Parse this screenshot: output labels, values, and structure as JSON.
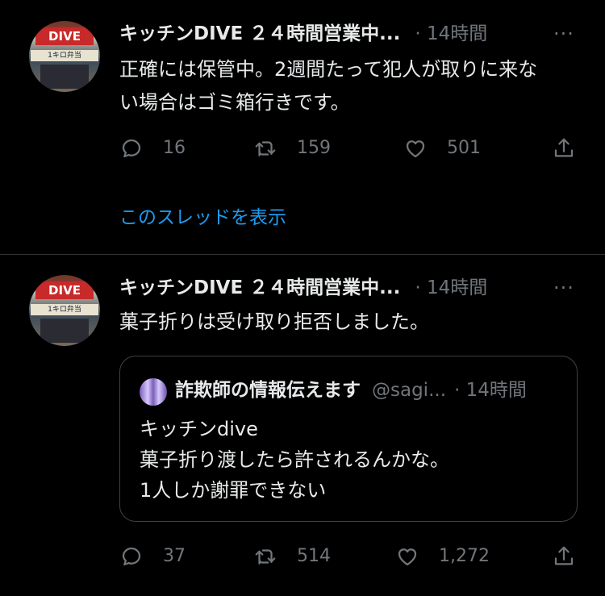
{
  "tweets": [
    {
      "avatar_sign": "DIVE",
      "avatar_banner": "1キロ弁当",
      "name": "キッチンDIVE ２４時間営業中...",
      "time": "· 14時間",
      "more": "···",
      "text_lines": [
        "正確には保管中。2週間たって犯人が取りに来な",
        "い場合はゴミ箱行きです。"
      ],
      "replies": "16",
      "retweets": "159",
      "likes": "501",
      "show_thread": "このスレッドを表示"
    },
    {
      "avatar_sign": "DIVE",
      "avatar_banner": "1キロ弁当",
      "name": "キッチンDIVE ２４時間営業中...",
      "time": "· 14時間",
      "more": "···",
      "text_lines": [
        "菓子折りは受け取り拒否しました。"
      ],
      "quote": {
        "name": "詐欺師の情報伝えます",
        "handle": "@sagi...",
        "time": "· 14時間",
        "text_lines": [
          "キッチンdive",
          "菓子折り渡したら許されるんかな。",
          "1人しか謝罪できない"
        ]
      },
      "replies": "37",
      "retweets": "514",
      "likes": "1,272"
    }
  ],
  "icons": [
    "reply-icon",
    "retweet-icon",
    "like-icon",
    "share-icon",
    "more-icon"
  ],
  "colors": {
    "background": "#000000",
    "text": "#e7e9ea",
    "muted": "#71767b",
    "link": "#1d9bf0",
    "border": "#2f3336"
  }
}
